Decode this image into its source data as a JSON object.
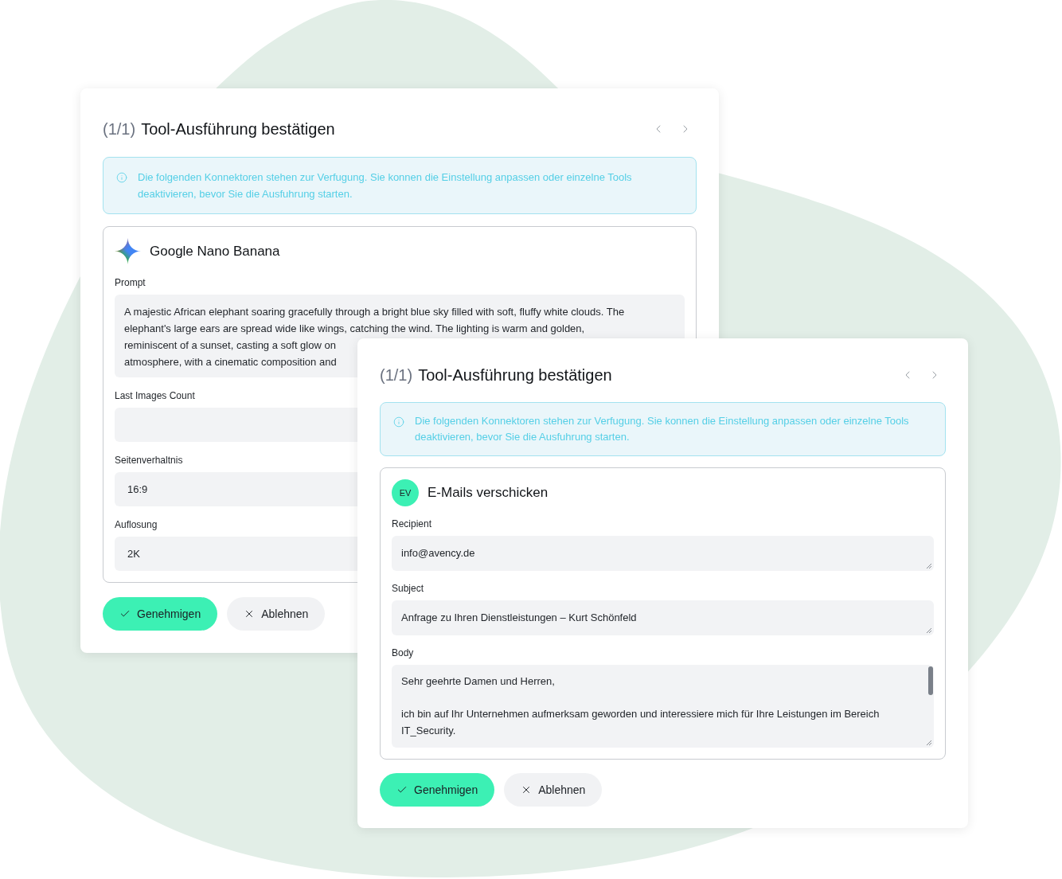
{
  "dialogs": [
    {
      "counter": "(1/1)",
      "title": "Tool-Ausführung bestätigen",
      "notice": "Die folgenden Konnektoren stehen zur Verfugung. Sie konnen die Einstellung anpassen oder einzelne Tools deaktivieren, bevor Sie die Ausfuhrung starten.",
      "tool": {
        "kind": "sparkle",
        "name": "Google Nano Banana"
      },
      "fields": [
        {
          "kind": "lines",
          "label": "Prompt",
          "lines": [
            "A majestic African elephant soaring gracefully through a bright blue sky filled with soft, fluffy white clouds. The",
            "elephant's large ears are spread wide like wings, catching the wind. The lighting is warm and golden,",
            "reminiscent of a sunset, casting a soft glow on",
            "atmosphere, with a cinematic composition and"
          ]
        },
        {
          "kind": "input",
          "label": "Last Images Count"
        },
        {
          "kind": "input",
          "label": "Seitenverhaltnis",
          "value": "16:9"
        },
        {
          "kind": "input",
          "label": "Auflosung",
          "value": "2K"
        }
      ],
      "buttons": [
        {
          "kind": "approve",
          "label": "Genehmigen"
        },
        {
          "kind": "reject",
          "label": "Ablehnen"
        }
      ]
    },
    {
      "counter": "(1/1)",
      "title": "Tool-Ausführung bestätigen",
      "notice": "Die folgenden Konnektoren stehen zur Verfugung. Sie konnen die Einstellung anpassen oder einzelne Tools deaktivieren, bevor Sie die Ausfuhrung starten.",
      "tool": {
        "kind": "avatar",
        "initials": "EV",
        "name": "E-Mails verschicken"
      },
      "fields": [
        {
          "kind": "textarea",
          "label": "Recipient",
          "value": "info@avency.de"
        },
        {
          "kind": "textarea",
          "label": "Subject",
          "value": "Anfrage zu Ihren Dienstleistungen – Kurt Schönfeld"
        },
        {
          "kind": "scrolling",
          "label": "Body",
          "value": "Sehr geehrte Damen und Herren,\n\nich bin auf Ihr Unternehmen aufmerksam geworden und interessiere mich für Ihre Leistungen im Bereich IT_Security."
        }
      ],
      "buttons": [
        {
          "kind": "approve",
          "label": "Genehmigen"
        },
        {
          "kind": "reject",
          "label": "Ablehnen"
        }
      ]
    }
  ]
}
